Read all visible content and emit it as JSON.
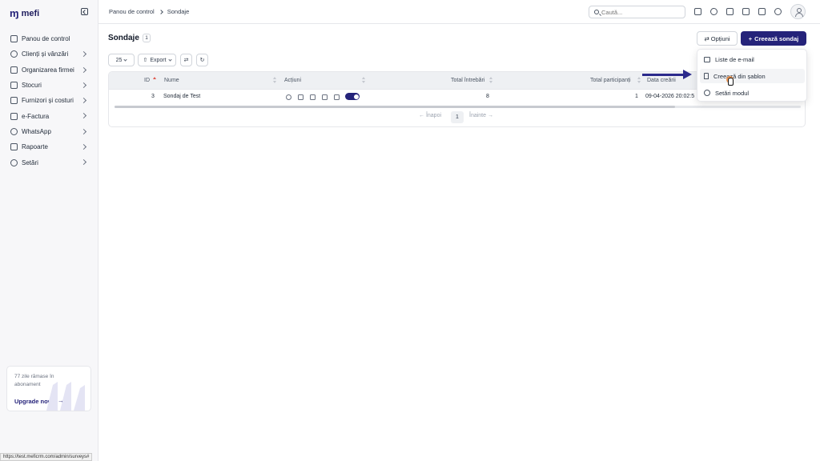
{
  "app": {
    "name": "mefi",
    "logo_mark": "ꟽ"
  },
  "sidebar": {
    "items": [
      {
        "label": "Panou de control",
        "icon": "home-icon",
        "chevron": false
      },
      {
        "label": "Clienți și vânzări",
        "icon": "users-icon",
        "chevron": true
      },
      {
        "label": "Organizarea firmei",
        "icon": "org-icon",
        "chevron": true
      },
      {
        "label": "Stocuri",
        "icon": "box-icon",
        "chevron": true
      },
      {
        "label": "Furnizori și costuri",
        "icon": "truck-icon",
        "chevron": true
      },
      {
        "label": "e-Factura",
        "icon": "link-icon",
        "chevron": true
      },
      {
        "label": "WhatsApp",
        "icon": "chat-icon",
        "chevron": true
      },
      {
        "label": "Rapoarte",
        "icon": "clipboard-icon",
        "chevron": true
      },
      {
        "label": "Setări",
        "icon": "gear-icon",
        "chevron": true
      }
    ],
    "upgrade": {
      "text": "77 zile rămase în abonament",
      "link": "Upgrade now",
      "arrow": "→"
    }
  },
  "status_url": "https://test.meficrm.com/admin/surveys#",
  "topbar": {
    "breadcrumb": [
      "Panou de control",
      "Sondaje"
    ],
    "search_placeholder": "Caută..."
  },
  "page": {
    "title": "Sondaje",
    "count": "1",
    "options_label": "Opțiuni",
    "create_label": "Creează sondaj",
    "create_prefix": "+",
    "options_prefix": "⇄"
  },
  "toolbar": {
    "page_size": "25",
    "export_label": "Export",
    "export_prefix": "⇧"
  },
  "table": {
    "headers": {
      "id": "ID",
      "name": "Nume",
      "actions": "Acțiuni",
      "total_questions": "Total întrebări",
      "total_participants": "Total participanți",
      "created": "Data creării"
    },
    "rows": [
      {
        "id": "3",
        "name": "Sondaj de Test",
        "total_questions": "8",
        "total_participants": "1",
        "created": "09-04-2026 20:02:5"
      }
    ],
    "pager": {
      "prev": "← Înapoi",
      "page": "1",
      "next": "Înainte →"
    }
  },
  "dropdown": {
    "items": [
      {
        "label": "Liste de e-mail",
        "icon": "mail-icon"
      },
      {
        "label": "Creează din șablon",
        "icon": "bookmark-icon"
      },
      {
        "label": "Setări modul",
        "icon": "gear-icon"
      }
    ]
  },
  "colors": {
    "brand": "#25237a",
    "sort_active": "#e05a4f",
    "cursor_highlight": "#f08a3c"
  }
}
